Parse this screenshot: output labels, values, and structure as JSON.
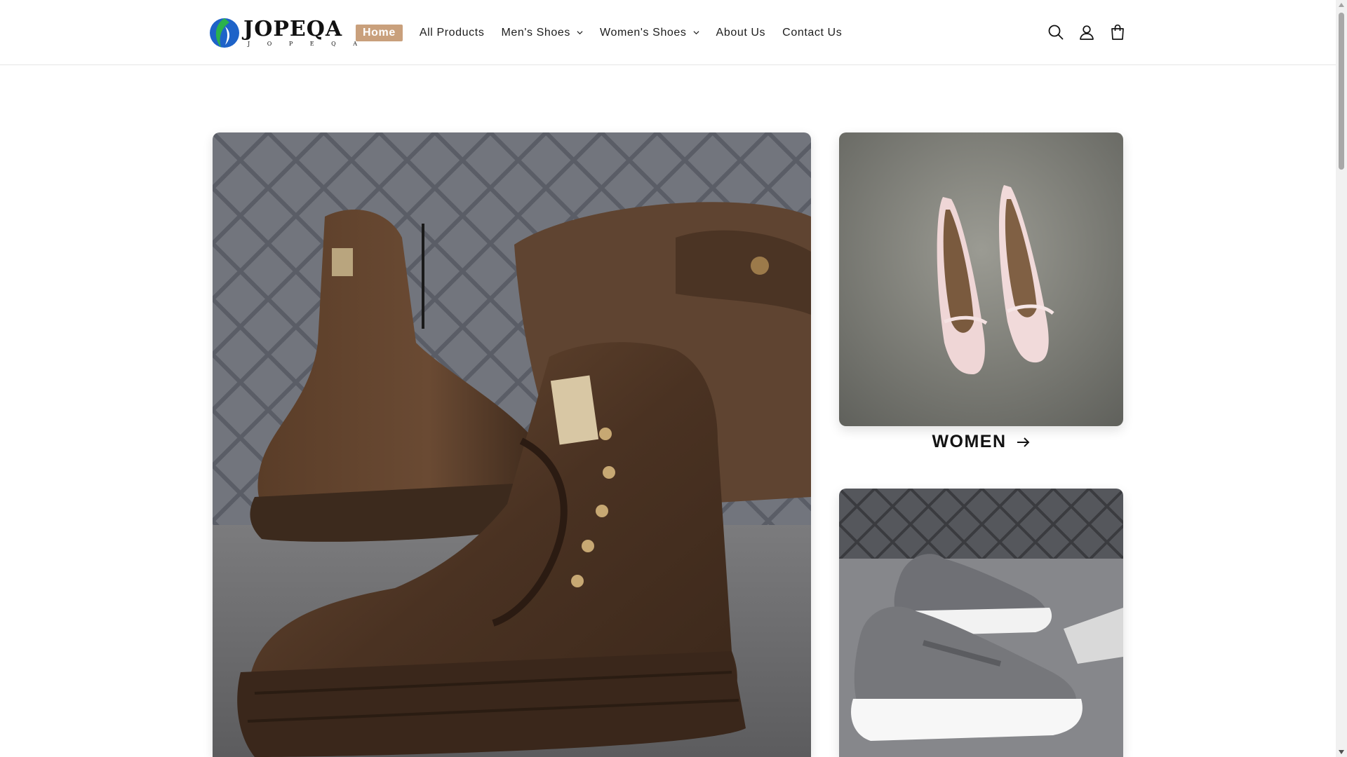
{
  "brand": {
    "name": "JOPEQA",
    "tagline": "J O P E Q A",
    "colors": {
      "green": "#2bb24c",
      "blue": "#1e63c8",
      "accent": "#c9a07c"
    }
  },
  "nav": {
    "items": [
      {
        "label": "Home",
        "active": true
      },
      {
        "label": "All Products"
      },
      {
        "label": "Men's Shoes",
        "dropdown": true
      },
      {
        "label": "Women's Shoes",
        "dropdown": true
      },
      {
        "label": "About Us"
      },
      {
        "label": "Contact Us"
      }
    ]
  },
  "header_icons": [
    "search-icon",
    "account-icon",
    "cart-icon"
  ],
  "hero": {
    "main_image": "brown-leather-boots-image",
    "women_card": {
      "label": "WOMEN",
      "image": "pink-flats-image"
    },
    "men_card": {
      "image": "grey-knit-sneakers-image"
    }
  }
}
